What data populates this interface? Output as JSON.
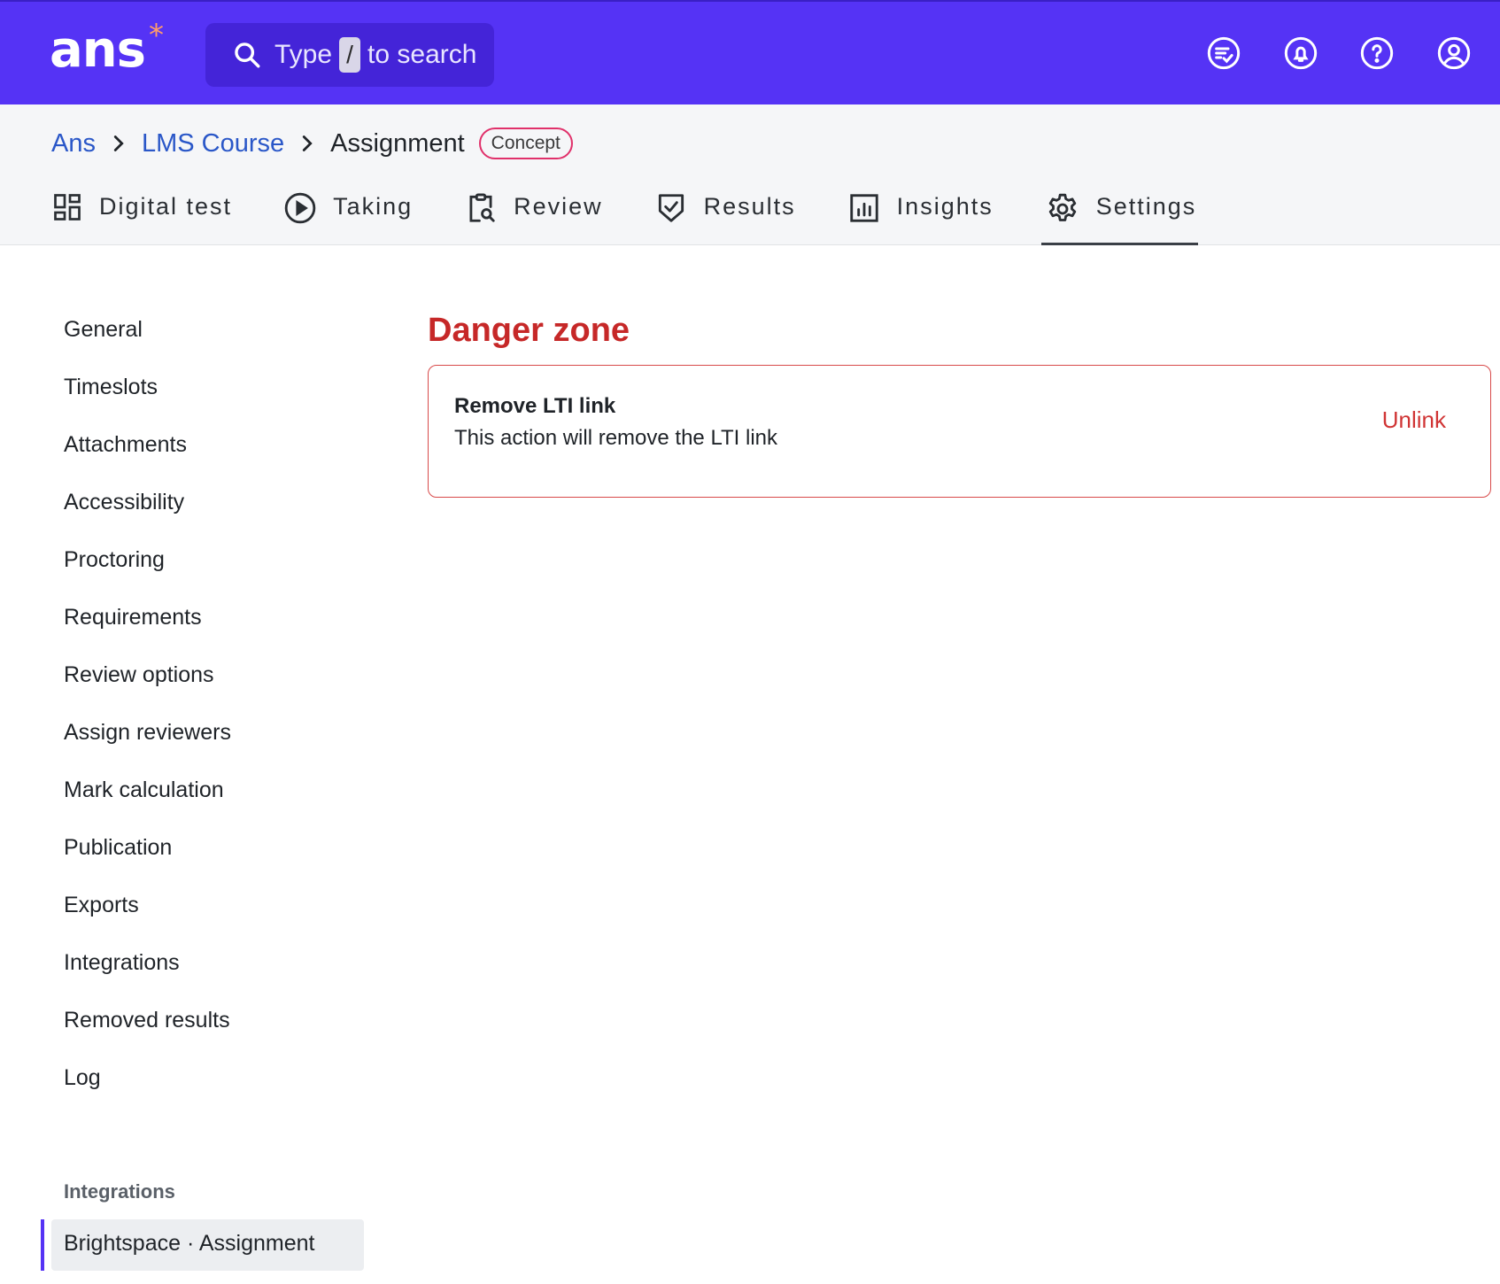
{
  "app": {
    "logo_text": "ans",
    "logo_mark": "*"
  },
  "search": {
    "prefix": "Type",
    "key": "/",
    "suffix": "to search"
  },
  "top_icons": [
    "review-list-icon",
    "notification-bell-icon",
    "help-icon",
    "user-account-icon"
  ],
  "breadcrumb": {
    "items": [
      "Ans",
      "LMS Course"
    ],
    "current": "Assignment",
    "badge": "Concept"
  },
  "tabs": [
    {
      "label": "Digital test",
      "icon": "dashboard-icon"
    },
    {
      "label": "Taking",
      "icon": "play-circle-icon"
    },
    {
      "label": "Review",
      "icon": "clipboard-search-icon"
    },
    {
      "label": "Results",
      "icon": "shield-check-icon"
    },
    {
      "label": "Insights",
      "icon": "bar-chart-icon"
    },
    {
      "label": "Settings",
      "icon": "gear-icon",
      "active": true
    }
  ],
  "sidebar": {
    "items": [
      "General",
      "Timeslots",
      "Attachments",
      "Accessibility",
      "Proctoring",
      "Requirements",
      "Review options",
      "Assign reviewers",
      "Mark calculation",
      "Publication",
      "Exports",
      "Integrations",
      "Removed results",
      "Log"
    ],
    "section_title": "Integrations",
    "active_item": "Brightspace · Assignment"
  },
  "danger": {
    "title": "Danger zone",
    "card_title": "Remove LTI link",
    "card_description": "This action will remove the LTI link",
    "action_label": "Unlink"
  },
  "colors": {
    "brand": "#5533f5",
    "danger": "#c62828",
    "badge_border": "#e0306a",
    "link": "#2a57c8"
  }
}
